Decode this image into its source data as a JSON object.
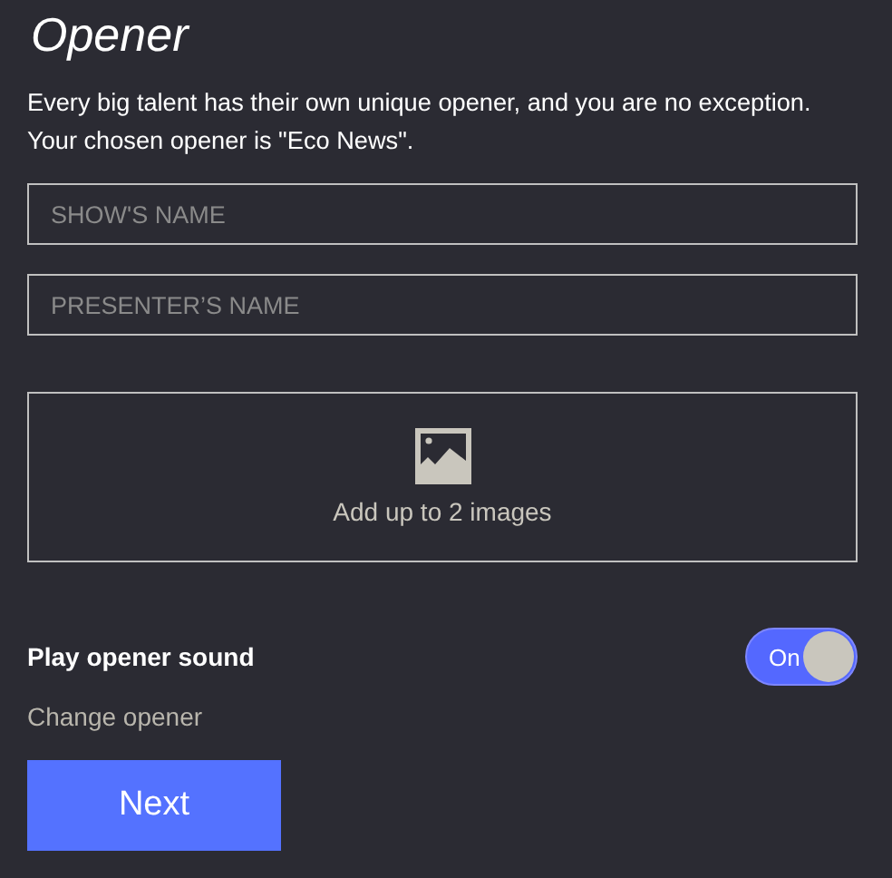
{
  "title": "Opener",
  "description": "Every big talent has their own unique opener, and you are no exception. Your chosen opener is \"Eco News\".",
  "fields": [
    {
      "placeholder": "SHOW'S NAME"
    },
    {
      "placeholder": "PRESENTER’S NAME"
    }
  ],
  "upload": {
    "label": "Add up to 2 images"
  },
  "sound_toggle": {
    "label": "Play opener sound",
    "on": true,
    "state_text": "On"
  },
  "change_link": "Change opener",
  "next_button": "Next"
}
